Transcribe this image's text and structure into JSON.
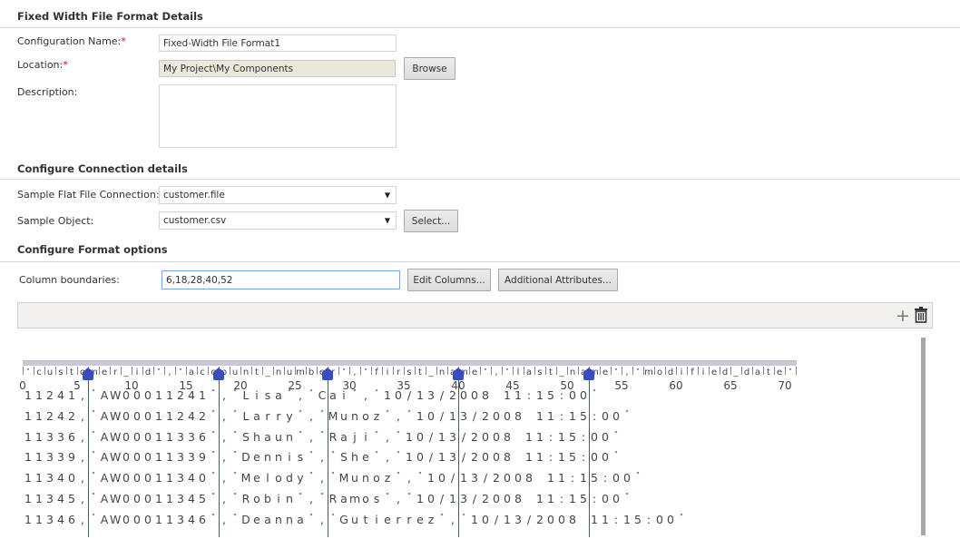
{
  "sections": {
    "details_title": "Fixed Width File Format Details",
    "connection_title": "Configure Connection details",
    "format_title": "Configure Format options"
  },
  "details": {
    "config_name_label": "Configuration Name:",
    "config_name_value": "Fixed-Width File Format1",
    "location_label": "Location:",
    "location_value": "My Project\\My Components",
    "browse_label": "Browse",
    "description_label": "Description:",
    "description_value": "",
    "required_mark": "*"
  },
  "connection": {
    "flat_file_label": "Sample Flat File Connection:",
    "flat_file_value": "customer.file",
    "object_label": "Sample Object:",
    "object_value": "customer.csv",
    "select_label": "Select...",
    "dropdown_glyph": "▼"
  },
  "format": {
    "boundaries_label": "Column boundaries:",
    "boundaries_value": "6,18,28,40,52",
    "edit_columns_label": "Edit Columns...",
    "additional_attributes_label": "Additional Attributes..."
  },
  "toolbar": {
    "add_icon": "plus-icon",
    "add_glyph": "+",
    "delete_icon": "trash-icon",
    "delete_glyph": "🗑"
  },
  "preview": {
    "header": "\"customer_id\",\"account_number\",\"first_name\",\"last_name\",\"modified_date\"",
    "ruler_labels": [
      "0",
      "5",
      "10",
      "15",
      "20",
      "25",
      "30",
      "35",
      "40",
      "45",
      "50",
      "55",
      "60",
      "65",
      "70"
    ],
    "boundaries": [
      6,
      18,
      28,
      40,
      52
    ],
    "rows": [
      "11241,\"AW00011241\",\"Lisa\",\"Cai\",\"10/13/2008 11:15:00\"",
      "11242,\"AW00011242\",\"Larry\",\"Munoz\",\"10/13/2008 11:15:00\"",
      "11336,\"AW00011336\",\"Shaun\",\"Raji\",\"10/13/2008 11:15:00\"",
      "11339,\"AW00011339\",\"Dennis\",\"She\",\"10/13/2008 11:15:00\"",
      "11340,\"AW00011340\",\"Melody\",\"Munoz\",\"10/13/2008 11:15:00\"",
      "11345,\"AW00011345\",\"Robin\",\"Ramos\",\"10/13/2008 11:15:00\"",
      "11346,\"AW00011346\",\"Deanna\",\"Gutierrez\",\"10/13/2008 11:15:00\""
    ]
  },
  "colors": {
    "boundary": "#3b4bc4",
    "required": "#d0021b",
    "readonly_field": "#ece9dc"
  }
}
